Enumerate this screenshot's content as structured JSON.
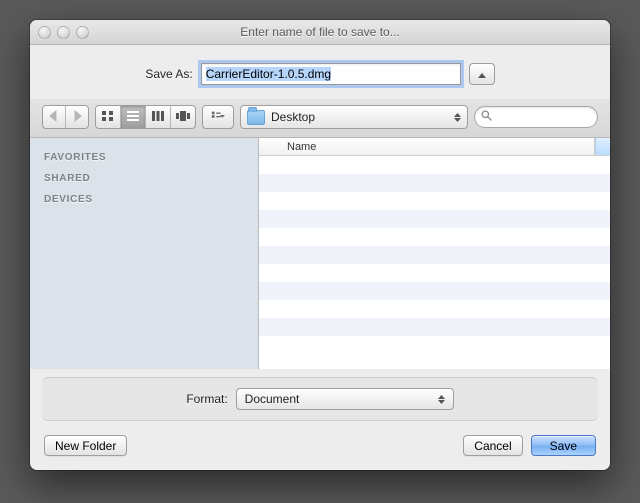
{
  "window": {
    "title": "Enter name of file to save to..."
  },
  "saveAs": {
    "label": "Save As:",
    "filename": "CarrierEditor-1.0.5.dmg"
  },
  "location": {
    "current": "Desktop"
  },
  "sidebar": {
    "headings": [
      "FAVORITES",
      "SHARED",
      "DEVICES"
    ]
  },
  "columns": {
    "name": "Name"
  },
  "format": {
    "label": "Format:",
    "value": "Document"
  },
  "buttons": {
    "newFolder": "New Folder",
    "cancel": "Cancel",
    "save": "Save"
  },
  "search": {
    "placeholder": ""
  }
}
